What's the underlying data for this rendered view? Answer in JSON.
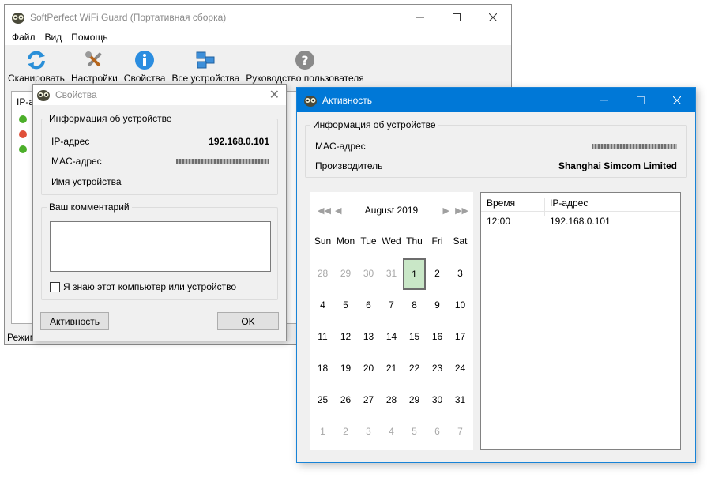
{
  "main_window": {
    "title": "SoftPerfect WiFi Guard (Портативная сборка)",
    "menu": [
      "Файл",
      "Вид",
      "Помощь"
    ],
    "toolbar": [
      {
        "label": "Сканировать",
        "icon": "scan-icon"
      },
      {
        "label": "Настройки",
        "icon": "settings-tools-icon"
      },
      {
        "label": "Свойства",
        "icon": "info-icon"
      },
      {
        "label": "Все устройства",
        "icon": "network-devices-icon"
      },
      {
        "label": "Руководство пользователя",
        "icon": "help-icon"
      }
    ],
    "list_header": "IP-а",
    "status_text": "Режим",
    "status_dots": [
      {
        "color": "#4caf2a"
      },
      {
        "color": "#e0503a"
      },
      {
        "color": "#4caf2a"
      }
    ],
    "dot_label": "1"
  },
  "properties_dialog": {
    "title": "Свойства",
    "device_info_group": "Информация об устройстве",
    "ip_label": "IP-адрес",
    "ip_value": "192.168.0.101",
    "mac_label": "MAC-адрес",
    "device_name_label": "Имя устройства",
    "comment_group": "Ваш комментарий",
    "comment_value": "",
    "known_checkbox_label": "Я знаю этот компьютер или устройство",
    "known_checked": false,
    "activity_button": "Активность",
    "ok_button": "OK"
  },
  "activity_window": {
    "title": "Активность",
    "device_info_group": "Информация об устройстве",
    "mac_label": "MAC-адрес",
    "vendor_label": "Производитель",
    "vendor_value": "Shanghai Simcom Limited",
    "calendar": {
      "month_label": "August 2019",
      "weekdays": [
        "Sun",
        "Mon",
        "Tue",
        "Wed",
        "Thu",
        "Fri",
        "Sat"
      ],
      "weeks": [
        [
          "28",
          "29",
          "30",
          "31",
          "1",
          "2",
          "3"
        ],
        [
          "4",
          "5",
          "6",
          "7",
          "8",
          "9",
          "10"
        ],
        [
          "11",
          "12",
          "13",
          "14",
          "15",
          "16",
          "17"
        ],
        [
          "18",
          "19",
          "20",
          "21",
          "22",
          "23",
          "24"
        ],
        [
          "25",
          "26",
          "27",
          "28",
          "29",
          "30",
          "31"
        ],
        [
          "1",
          "2",
          "3",
          "4",
          "5",
          "6",
          "7"
        ]
      ],
      "selected_day": "1"
    },
    "log": {
      "columns": [
        "Время",
        "IP-адрес"
      ],
      "rows": [
        [
          "12:00",
          "192.168.0.101"
        ]
      ]
    }
  },
  "colors": {
    "active_titlebar": "#0078d7",
    "selected_day_bg": "#c9e7c7"
  }
}
